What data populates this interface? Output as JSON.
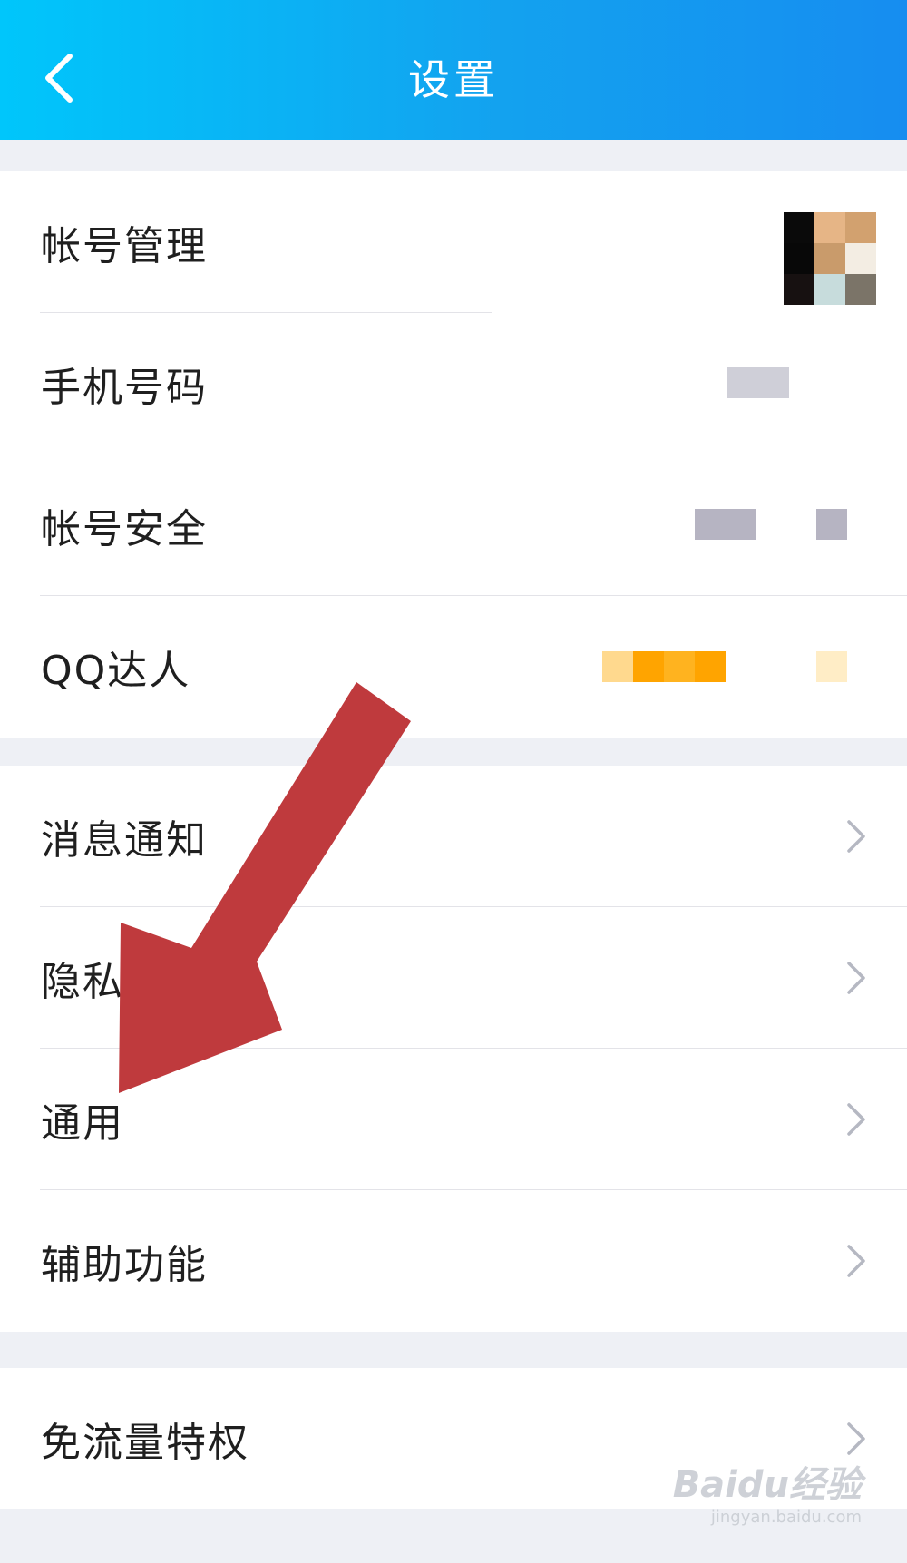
{
  "header": {
    "title": "设置",
    "back_icon": "chevron-left-icon"
  },
  "group1": {
    "items": [
      {
        "label": "帐号管理"
      },
      {
        "label": "手机号码"
      },
      {
        "label": "帐号安全"
      },
      {
        "label": "QQ达人"
      }
    ]
  },
  "group2": {
    "items": [
      {
        "label": "消息通知"
      },
      {
        "label": "隐私"
      },
      {
        "label": "通用"
      },
      {
        "label": "辅助功能"
      }
    ]
  },
  "group3": {
    "items": [
      {
        "label": "免流量特权"
      }
    ]
  },
  "overlay": {
    "annotation": "red-arrow",
    "color": "#bf3a3d"
  },
  "watermark": {
    "brand": "Baidu经验",
    "url": "jingyan.baidu.com"
  },
  "colors": {
    "header_start": "#00c6fb",
    "header_end": "#168df0",
    "background": "#eef0f5",
    "chevron": "#b5b8c2"
  }
}
